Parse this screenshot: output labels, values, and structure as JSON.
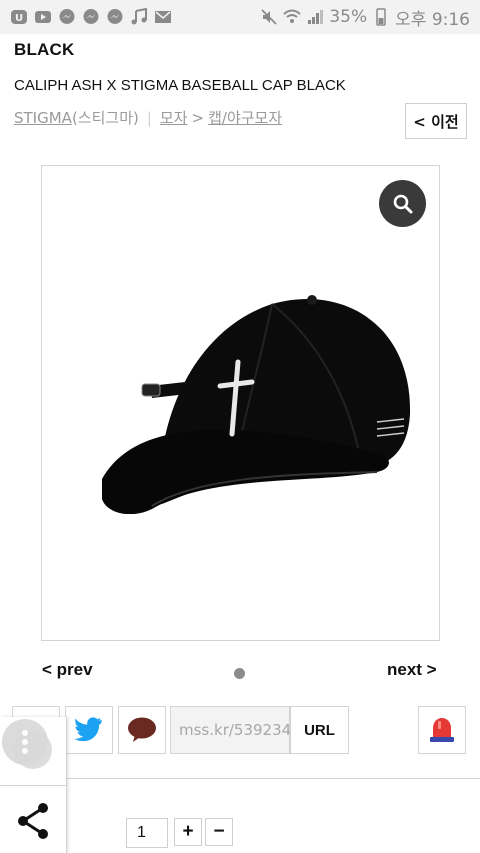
{
  "status_bar": {
    "battery": "35%",
    "time": "오후 9:16",
    "icons": [
      "app-icon",
      "youtube-icon",
      "messenger-icon",
      "messenger-icon",
      "messenger-icon",
      "music-icon",
      "mail-icon",
      "mute-icon",
      "wifi-icon",
      "signal-icon",
      "battery-icon"
    ]
  },
  "header": {
    "brand_label": "BLACK",
    "product_name": "CALIPH ASH X STIGMA BASEBALL CAP BLACK",
    "back_label": "< 이전"
  },
  "breadcrumb": {
    "brand": "STIGMA",
    "brand_korean": "(스티그마)",
    "category": "모자",
    "separator": ">",
    "subcategory": "캡/야구모자"
  },
  "image": {
    "subject": "black baseball cap with cross embroidery",
    "zoom_icon": "search-icon"
  },
  "pager": {
    "prev_label": "< prev",
    "next_label": "next >"
  },
  "share": {
    "url_value": "mss.kr/539234",
    "url_button": "URL",
    "icons": [
      "facebook-icon",
      "twitter-icon",
      "kakaotalk-icon",
      "alarm-icon"
    ]
  },
  "quantity": {
    "value": "1",
    "plus": "+",
    "minus": "−"
  },
  "colors": {
    "status_bar_bg": "#f2f2f2",
    "twitter": "#1da1f2",
    "talk": "#6b2a21",
    "alarm": "#e53935",
    "zoom_bg": "#3a3a3a"
  }
}
